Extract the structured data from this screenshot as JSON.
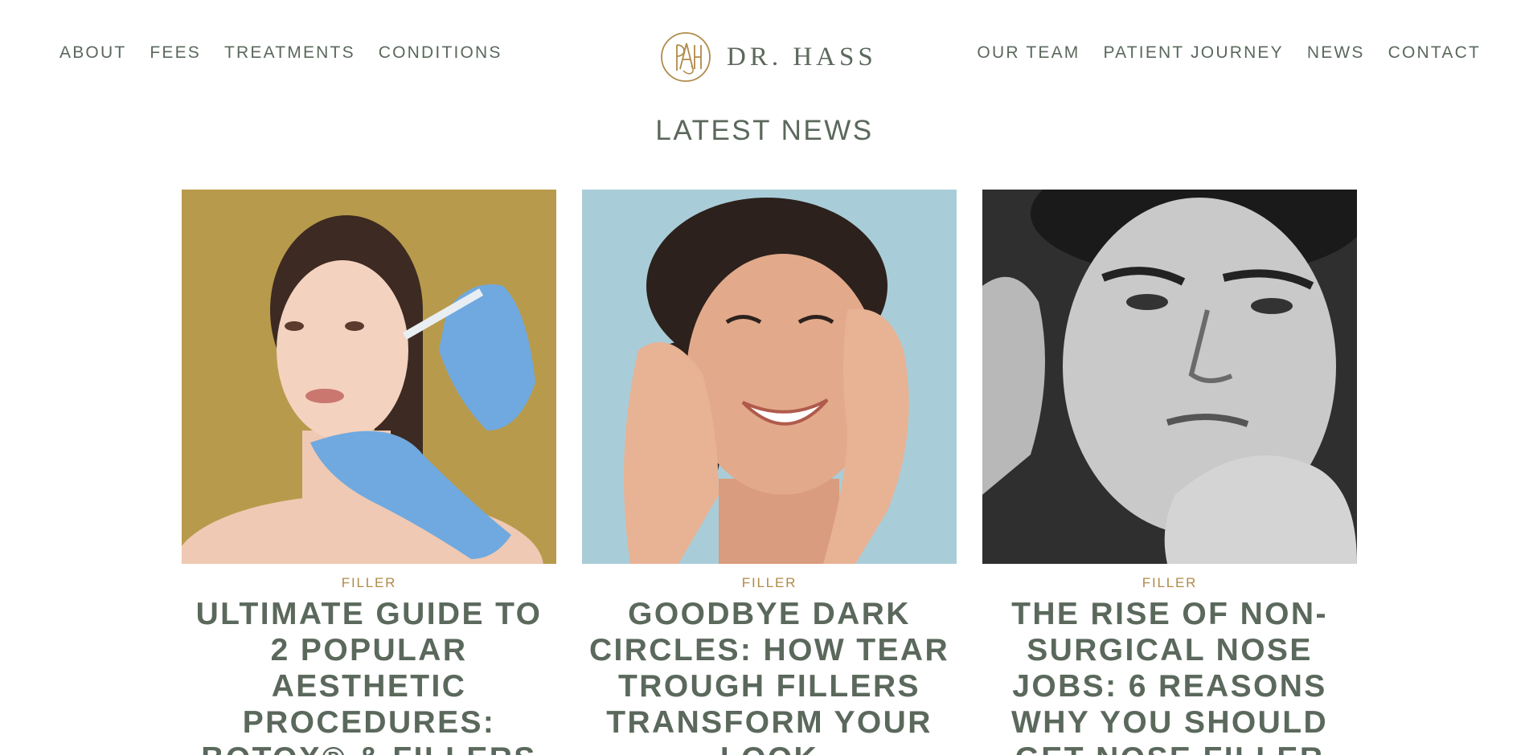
{
  "nav": {
    "left": [
      {
        "label": "ABOUT"
      },
      {
        "label": "FEES"
      },
      {
        "label": "TREATMENTS"
      },
      {
        "label": "CONDITIONS"
      }
    ],
    "right": [
      {
        "label": "OUR TEAM"
      },
      {
        "label": "PATIENT JOURNEY"
      },
      {
        "label": "NEWS"
      },
      {
        "label": "CONTACT"
      }
    ]
  },
  "logo": {
    "text": "DR. HASS",
    "mark_icon": "pah-monogram-icon",
    "mark_color": "#b08b4a"
  },
  "section": {
    "title": "LATEST NEWS"
  },
  "articles": [
    {
      "category": "FILLER",
      "title": "ULTIMATE GUIDE TO 2 POPULAR AESTHETIC PROCEDURES: BOTOX® & FILLERS",
      "image_bg": "#b89a4c"
    },
    {
      "category": "FILLER",
      "title": "GOODBYE DARK CIRCLES: HOW TEAR TROUGH FILLERS TRANSFORM YOUR LOOK",
      "image_bg": "#a9cdd8"
    },
    {
      "category": "FILLER",
      "title": "THE RISE OF NON-SURGICAL NOSE JOBS: 6 REASONS WHY YOU SHOULD GET NOSE FILLER",
      "image_bg": "#3a3a3a"
    }
  ],
  "colors": {
    "text": "#5b685c",
    "accent": "#b08b4a",
    "background": "#ffffff"
  }
}
